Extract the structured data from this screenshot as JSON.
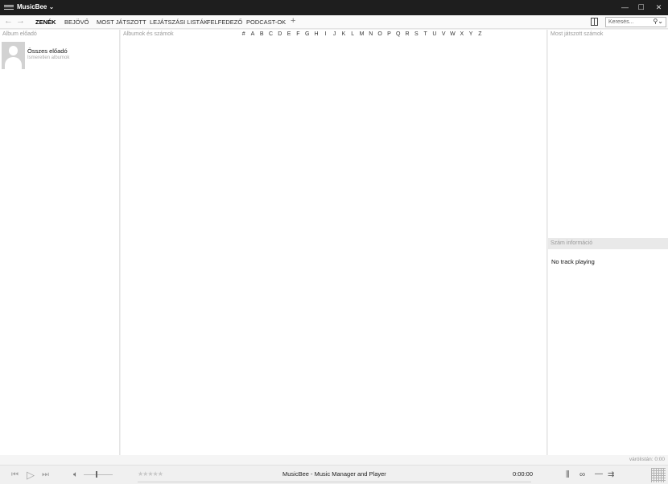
{
  "app": {
    "title": "MusicBee ⌄"
  },
  "nav": {
    "tabs": [
      {
        "label": "ZENÉK",
        "active": true
      },
      {
        "label": "BEJÖVŐ"
      },
      {
        "label": "MOST JÁTSZOTT"
      },
      {
        "label": "LEJÁTSZÁSI LISTÁK"
      },
      {
        "label": "FELFEDEZŐ"
      },
      {
        "label": "PODCAST-OK"
      }
    ],
    "add_tab": "+"
  },
  "search": {
    "placeholder": "Keresés..."
  },
  "left_panel": {
    "header": "Album előadó",
    "artist": {
      "name": "Összes előadó",
      "subtitle": "Ismeretlen albumok"
    }
  },
  "center_panel": {
    "header": "Albumok és számok",
    "alphabet": [
      "#",
      "A",
      "B",
      "C",
      "D",
      "E",
      "F",
      "G",
      "H",
      "I",
      "J",
      "K",
      "L",
      "M",
      "N",
      "O",
      "P",
      "Q",
      "R",
      "S",
      "T",
      "U",
      "V",
      "W",
      "X",
      "Y",
      "Z"
    ]
  },
  "right_panel": {
    "header": "Most játszott számok",
    "track_info_header": "Szám információ",
    "no_track": "No track playing"
  },
  "status": {
    "text": "várólistán: 0:00"
  },
  "player": {
    "stars": "★★★★★",
    "now_playing": "MusicBee - Music Manager and Player",
    "time": "0:00:00"
  },
  "icons": {
    "menu": "hamburger-icon",
    "back": "back-arrow-icon",
    "forward": "forward-arrow-icon",
    "layout": "layout-panel-icon",
    "search": "search-icon",
    "prev": "previous-track-icon",
    "play": "play-icon",
    "next": "next-track-icon",
    "volume": "speaker-icon",
    "equalizer": "equalizer-icon",
    "scrobble": "scrobble-icon",
    "stop_after": "stop-after-icon",
    "shuffle": "shuffle-icon",
    "visualizer": "grid-icon"
  }
}
